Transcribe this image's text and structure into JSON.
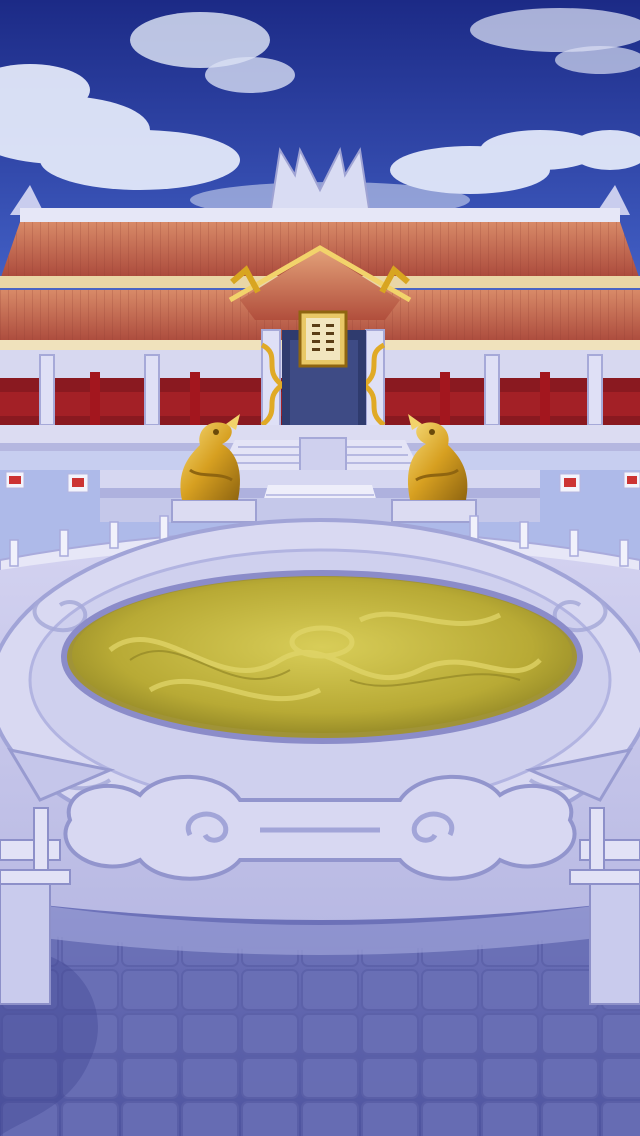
{
  "scene": {
    "name": "imperial-palace-courtyard",
    "plaque_text": "",
    "colors": {
      "sky_top": "#1f2f8f",
      "sky_mid": "#3a55b8",
      "sky_low": "#8fa6e6",
      "roof_tile": "#c8684e",
      "roof_tile_dark": "#9c3f35",
      "pillar_red": "#a3161e",
      "gold": "#d8a520",
      "gold_light": "#f2d36b",
      "stone": "#c9c9ec",
      "stone_shadow": "#8c8fcf",
      "dragon_floor": "#b5a634",
      "dragon_floor_light": "#d6cb55",
      "courtyard_floor": "#5f64ad"
    },
    "icons": [
      "dragon-statue-left",
      "dragon-statue-right",
      "plaque",
      "lantern"
    ]
  }
}
